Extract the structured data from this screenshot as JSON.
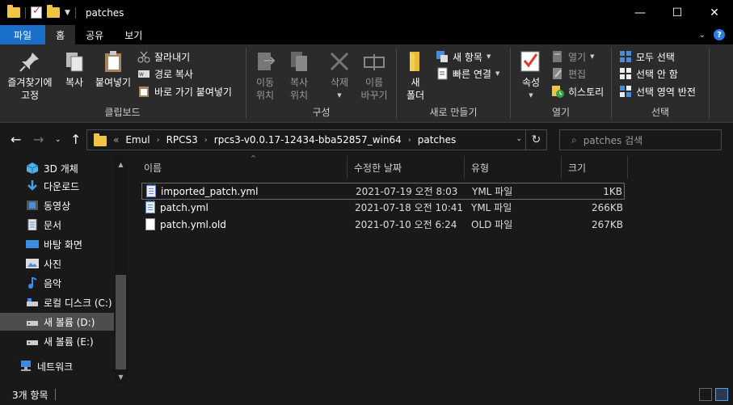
{
  "window": {
    "title": "patches",
    "controls": {
      "minimize": "—",
      "maximize": "☐",
      "close": "✕"
    }
  },
  "ribbon_tabs": [
    "파일",
    "홈",
    "공유",
    "보기"
  ],
  "ribbon": {
    "clipboard": {
      "label": "클립보드",
      "pin": "즐겨찾기에\n고정",
      "copy": "복사",
      "paste": "붙여넣기",
      "cut": "잘라내기",
      "copy_path": "경로 복사",
      "paste_shortcut": "바로 가기 붙여넣기"
    },
    "organize": {
      "label": "구성",
      "move_to": "이동\n위치",
      "copy_to": "복사\n위치",
      "delete": "삭제",
      "rename": "이름\n바꾸기"
    },
    "new": {
      "label": "새로 만들기",
      "new_folder": "새\n폴더",
      "new_item": "새 항목",
      "easy_access": "빠른 연결"
    },
    "open": {
      "label": "열기",
      "properties": "속성",
      "open": "열기",
      "edit": "편집",
      "history": "히스토리"
    },
    "select": {
      "label": "선택",
      "select_all": "모두 선택",
      "select_none": "선택 안 함",
      "invert": "선택 영역 반전"
    }
  },
  "address": {
    "overflow": "«",
    "crumbs": [
      "Emul",
      "RPCS3",
      "rpcs3-v0.0.17-12434-bba52857_win64",
      "patches"
    ],
    "search_placeholder": "patches 검색"
  },
  "sidebar": {
    "items": [
      {
        "label": "3D 개체",
        "icon": "3d-objects-icon",
        "selected": false
      },
      {
        "label": "다운로드",
        "icon": "download-icon",
        "selected": false
      },
      {
        "label": "동영상",
        "icon": "video-icon",
        "selected": false
      },
      {
        "label": "문서",
        "icon": "documents-icon",
        "selected": false
      },
      {
        "label": "바탕 화면",
        "icon": "desktop-icon",
        "selected": false
      },
      {
        "label": "사진",
        "icon": "pictures-icon",
        "selected": false
      },
      {
        "label": "음악",
        "icon": "music-icon",
        "selected": false
      },
      {
        "label": "로컬 디스크 (C:)",
        "icon": "drive-icon",
        "selected": false
      },
      {
        "label": "새 볼륨 (D:)",
        "icon": "drive-icon",
        "selected": true
      },
      {
        "label": "새 볼륨 (E:)",
        "icon": "drive-icon",
        "selected": false
      },
      {
        "label": "네트워크",
        "icon": "network-icon",
        "selected": false
      }
    ]
  },
  "columns": [
    "이름",
    "수정한 날짜",
    "유형",
    "크기"
  ],
  "files": [
    {
      "name": "imported_patch.yml",
      "date": "2021-07-19 오전 8:03",
      "type": "YML 파일",
      "size": "1KB",
      "icon": "notepad-file-icon"
    },
    {
      "name": "patch.yml",
      "date": "2021-07-18 오전 10:41",
      "type": "YML 파일",
      "size": "266KB",
      "icon": "notepad-file-icon"
    },
    {
      "name": "patch.yml.old",
      "date": "2021-07-10 오전 6:24",
      "type": "OLD 파일",
      "size": "267KB",
      "icon": "blank-file-icon"
    }
  ],
  "status": {
    "count": "3개 항목"
  },
  "colors": {
    "file_tab": "#1a6fc8",
    "folder": "#f0c445",
    "background": "#191919",
    "ribbon": "#2b2b2b"
  }
}
